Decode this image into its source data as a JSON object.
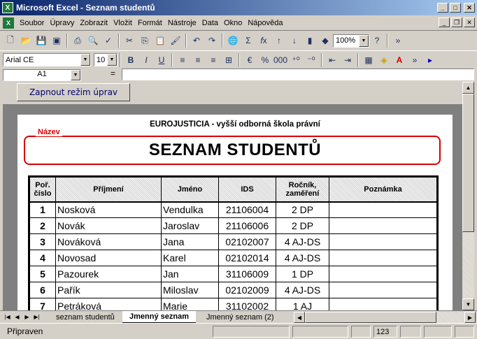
{
  "window": {
    "title": "Microsoft Excel - Seznam studentů"
  },
  "menu": {
    "items": [
      "Soubor",
      "Úpravy",
      "Zobrazit",
      "Vložit",
      "Formát",
      "Nástroje",
      "Data",
      "Okno",
      "Nápověda"
    ]
  },
  "toolbar": {
    "zoom": "100%",
    "font_name": "Arial CE",
    "font_size": "10"
  },
  "formula_bar": {
    "cell_ref": "A1",
    "equals": "=",
    "value": ""
  },
  "edit_button": "Zapnout režim úprav",
  "sheet": {
    "school": "EUROJUSTICIA - vyšší odborná škola právní",
    "name_label": "Název",
    "title": "SEZNAM STUDENTŮ",
    "headers": {
      "no_1": "Poř.",
      "no_2": "číslo",
      "surname": "Příjmení",
      "name": "Jméno",
      "ids": "IDS",
      "year_1": "Ročník,",
      "year_2": "zaměření",
      "note": "Poznámka"
    },
    "rows": [
      {
        "no": "1",
        "surname": "Nosková",
        "name": "Vendulka",
        "ids": "21106004",
        "year": "2 DP",
        "note": ""
      },
      {
        "no": "2",
        "surname": "Novák",
        "name": "Jaroslav",
        "ids": "21106006",
        "year": "2 DP",
        "note": ""
      },
      {
        "no": "3",
        "surname": "Nováková",
        "name": "Jana",
        "ids": "02102007",
        "year": "4 AJ-DS",
        "note": ""
      },
      {
        "no": "4",
        "surname": "Novosad",
        "name": "Karel",
        "ids": "02102014",
        "year": "4 AJ-DS",
        "note": ""
      },
      {
        "no": "5",
        "surname": "Pazourek",
        "name": "Jan",
        "ids": "31106009",
        "year": "1 DP",
        "note": ""
      },
      {
        "no": "6",
        "surname": "Pařík",
        "name": "Miloslav",
        "ids": "02102009",
        "year": "4 AJ-DS",
        "note": ""
      },
      {
        "no": "7",
        "surname": "Petráková",
        "name": "Marie",
        "ids": "31102002",
        "year": "1 AJ",
        "note": ""
      }
    ]
  },
  "tabs": [
    "seznam studentů",
    "Jmenný seznam",
    "Jmenný seznam (2)"
  ],
  "status": {
    "text": "Připraven",
    "num": "123"
  }
}
